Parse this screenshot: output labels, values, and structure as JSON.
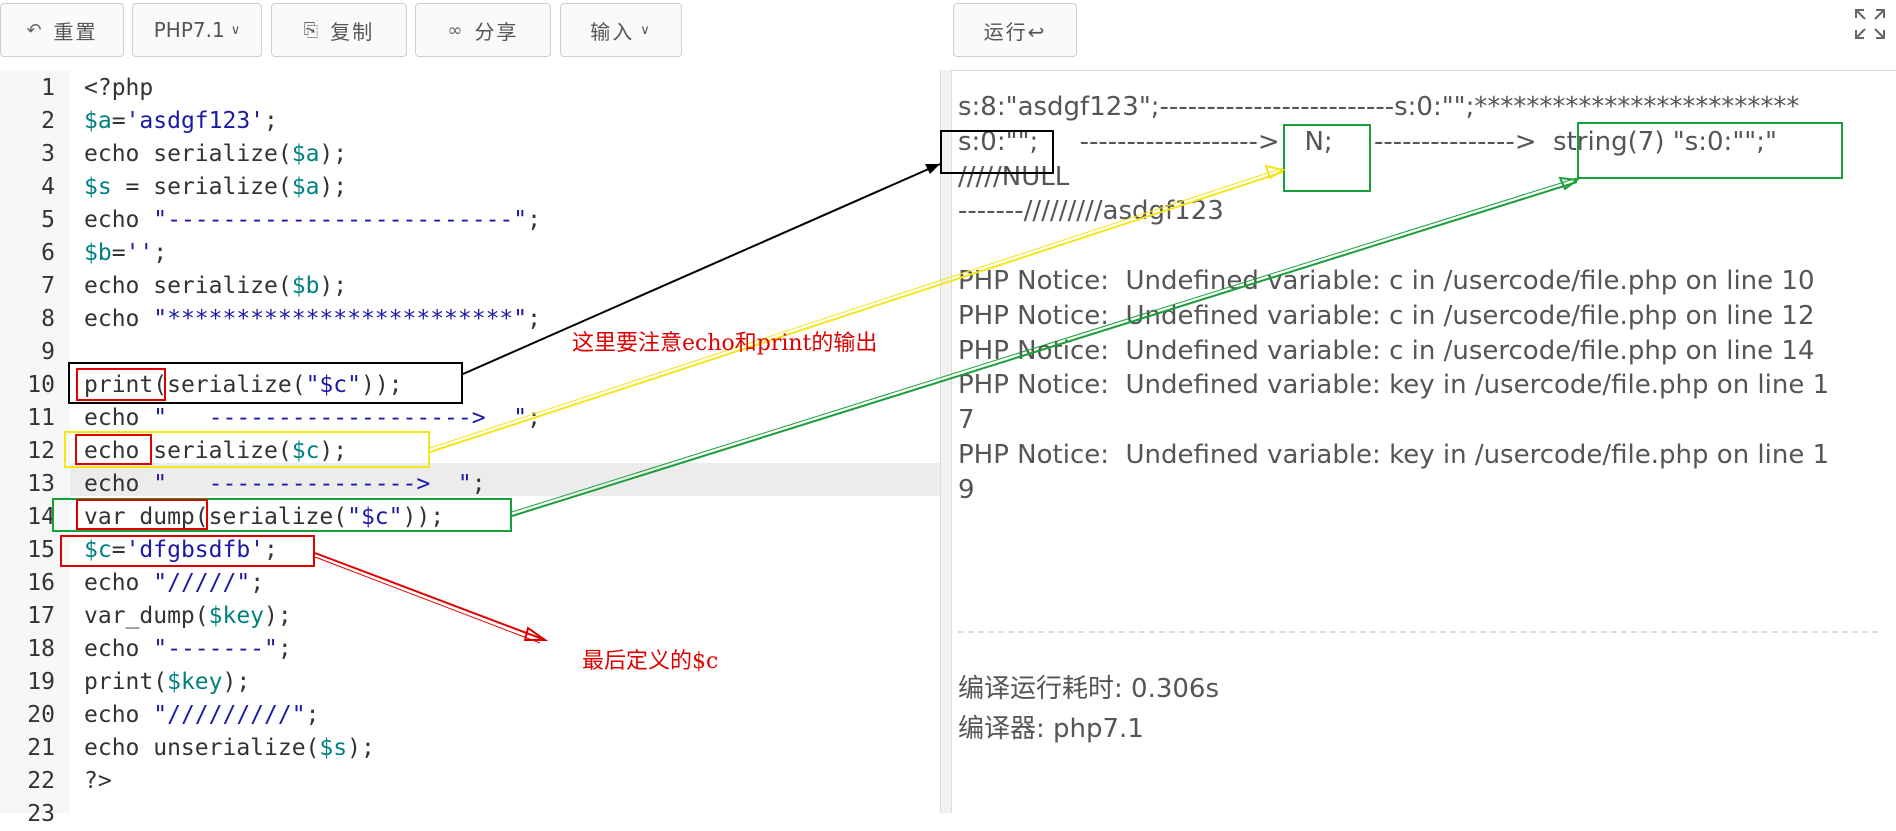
{
  "toolbar": {
    "reset_label": "重置",
    "version_label": "PHP7.1",
    "copy_label": "复制",
    "share_label": "分享",
    "input_label": "输入",
    "run_label": "运行↩"
  },
  "editor": {
    "line_numbers": [
      "1",
      "2",
      "3",
      "4",
      "5",
      "6",
      "7",
      "8",
      "9",
      "10",
      "11",
      "12",
      "13",
      "14",
      "15",
      "16",
      "17",
      "18",
      "19",
      "20",
      "21",
      "22",
      "23"
    ],
    "lines": [
      [
        {
          "t": "<?php",
          "c": "kw"
        }
      ],
      [
        {
          "t": "$a",
          "c": "vr"
        },
        {
          "t": "=",
          "c": "kw"
        },
        {
          "t": "'asdgf123'",
          "c": "st"
        },
        {
          "t": ";",
          "c": "kw"
        }
      ],
      [
        {
          "t": "echo serialize(",
          "c": "kw"
        },
        {
          "t": "$a",
          "c": "vr"
        },
        {
          "t": ");",
          "c": "kw"
        }
      ],
      [
        {
          "t": "$s",
          "c": "vr"
        },
        {
          "t": " = serialize(",
          "c": "kw"
        },
        {
          "t": "$a",
          "c": "vr"
        },
        {
          "t": ");",
          "c": "kw"
        }
      ],
      [
        {
          "t": "echo ",
          "c": "kw"
        },
        {
          "t": "\"-------------------------\"",
          "c": "st"
        },
        {
          "t": ";",
          "c": "kw"
        }
      ],
      [
        {
          "t": "$b",
          "c": "vr"
        },
        {
          "t": "=",
          "c": "kw"
        },
        {
          "t": "''",
          "c": "st"
        },
        {
          "t": ";",
          "c": "kw"
        }
      ],
      [
        {
          "t": "echo serialize(",
          "c": "kw"
        },
        {
          "t": "$b",
          "c": "vr"
        },
        {
          "t": ");",
          "c": "kw"
        }
      ],
      [
        {
          "t": "echo ",
          "c": "kw"
        },
        {
          "t": "\"*************************\"",
          "c": "st"
        },
        {
          "t": ";",
          "c": "kw"
        }
      ],
      [],
      [
        {
          "t": "print",
          "c": "kw"
        },
        {
          "t": "(serialize(",
          "c": "kw"
        },
        {
          "t": "\"$c\"",
          "c": "st"
        },
        {
          "t": "));",
          "c": "kw"
        }
      ],
      [
        {
          "t": "echo ",
          "c": "kw"
        },
        {
          "t": "\"   ------------------->  \"",
          "c": "st"
        },
        {
          "t": ";",
          "c": "kw"
        }
      ],
      [
        {
          "t": "echo",
          "c": "kw"
        },
        {
          "t": " serialize(",
          "c": "kw"
        },
        {
          "t": "$c",
          "c": "vr"
        },
        {
          "t": ");",
          "c": "kw"
        }
      ],
      [
        {
          "t": "echo ",
          "c": "kw"
        },
        {
          "t": "\"   --------------->  \"",
          "c": "st"
        },
        {
          "t": ";",
          "c": "kw"
        }
      ],
      [
        {
          "t": "var_dump",
          "c": "kw"
        },
        {
          "t": "(serialize(",
          "c": "kw"
        },
        {
          "t": "\"$c\"",
          "c": "st"
        },
        {
          "t": "));",
          "c": "kw"
        }
      ],
      [
        {
          "t": "$c",
          "c": "vr"
        },
        {
          "t": "=",
          "c": "kw"
        },
        {
          "t": "'dfgbsdfb'",
          "c": "st"
        },
        {
          "t": ";",
          "c": "kw"
        }
      ],
      [
        {
          "t": "echo ",
          "c": "kw"
        },
        {
          "t": "\"/////\"",
          "c": "st"
        },
        {
          "t": ";",
          "c": "kw"
        }
      ],
      [
        {
          "t": "var_dump(",
          "c": "kw"
        },
        {
          "t": "$key",
          "c": "vr"
        },
        {
          "t": ");",
          "c": "kw"
        }
      ],
      [
        {
          "t": "echo ",
          "c": "kw"
        },
        {
          "t": "\"-------\"",
          "c": "st"
        },
        {
          "t": ";",
          "c": "kw"
        }
      ],
      [
        {
          "t": "print(",
          "c": "kw"
        },
        {
          "t": "$key",
          "c": "vr"
        },
        {
          "t": ");",
          "c": "kw"
        }
      ],
      [
        {
          "t": "echo ",
          "c": "kw"
        },
        {
          "t": "\"/////////\"",
          "c": "st"
        },
        {
          "t": ";",
          "c": "kw"
        }
      ],
      [
        {
          "t": "echo unserialize(",
          "c": "kw"
        },
        {
          "t": "$s",
          "c": "vr"
        },
        {
          "t": ");",
          "c": "kw"
        }
      ],
      [
        {
          "t": "?>",
          "c": "kw"
        }
      ],
      []
    ]
  },
  "output": {
    "lines": [
      "s:8:\"asdgf123\";-------------------------s:0:\"\";*************************",
      "s:0:\"\";     ------------------->   N;     --------------->  string(7) \"s:0:\"\";\"",
      "/////NULL",
      "-------/////////asdgf123",
      "",
      "PHP Notice:  Undefined variable: c in /usercode/file.php on line 10",
      "PHP Notice:  Undefined variable: c in /usercode/file.php on line 12",
      "PHP Notice:  Undefined variable: c in /usercode/file.php on line 14",
      "PHP Notice:  Undefined variable: key in /usercode/file.php on line 1",
      "7",
      "PHP Notice:  Undefined variable: key in /usercode/file.php on line 1",
      "9"
    ],
    "compile_time": "编译运行耗时: 0.306s",
    "compiler": "编译器: php7.1"
  },
  "annotations": {
    "note_echo_print": "这里要注意echo和print的输出",
    "note_last_defined": "最后定义的$c"
  },
  "colors": {
    "black_box": "#000000",
    "yellow_box": "#f5e51b",
    "green_box": "#1a9e3a",
    "red_box": "#e00000"
  }
}
